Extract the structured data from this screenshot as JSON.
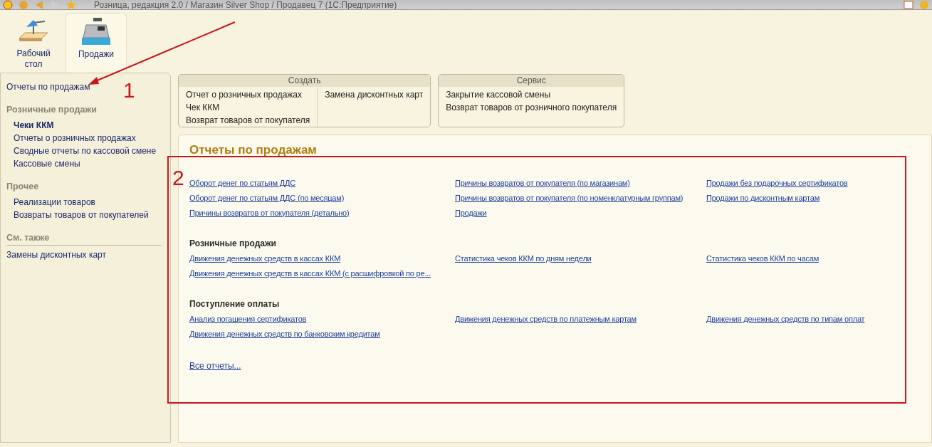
{
  "window": {
    "title": "Розница, редакция 2.0 / Магазин Silver Shop / Продавец 7  (1С:Предприятие)"
  },
  "sections": [
    {
      "label": "Рабочий стол",
      "kind": "desk",
      "selected": false
    },
    {
      "label": "Продажи",
      "kind": "register",
      "selected": true
    }
  ],
  "sidebar": {
    "top_link": "Отчеты по продажам",
    "groups": [
      {
        "title": "Розничные продажи",
        "items": [
          {
            "label": "Чеки ККМ",
            "selected": true
          },
          {
            "label": "Отчеты о розничных продажах",
            "selected": false
          },
          {
            "label": "Сводные отчеты по кассовой смене",
            "selected": false
          },
          {
            "label": "Кассовые смены",
            "selected": false
          }
        ]
      },
      {
        "title": "Прочее",
        "items": [
          {
            "label": "Реализации товаров",
            "selected": false
          },
          {
            "label": "Возвраты товаров от покупателей",
            "selected": false
          }
        ]
      }
    ],
    "see_also": {
      "title": "См. также",
      "items": [
        "Замены дисконтных карт"
      ]
    }
  },
  "command_panels": [
    {
      "title": "Создать",
      "columns": [
        [
          "Отчет о розничных продажах",
          "Чек ККМ",
          "Возврат товаров от покупателя"
        ],
        [
          "Замена дисконтных карт"
        ]
      ]
    },
    {
      "title": "Сервис",
      "columns": [
        [
          "Закрытие кассовой смены",
          "Возврат товаров от розничного покупателя"
        ]
      ]
    }
  ],
  "reports": {
    "title": "Отчеты по продажам",
    "groups": [
      {
        "columns": [
          [
            "Оборот денег по статьям ДДС",
            "Оборот денег по статьям ДДС (по месяцам)",
            "Причины возвратов от покупателя (детально)"
          ],
          [
            "Причины возвратов от покупателя (по магазинам)",
            "Причины возвратов от покупателя (по номенклатурным группам)",
            "Продажи"
          ],
          [
            "Продажи без подарочных сертификатов",
            "Продажи по дисконтным картам"
          ]
        ]
      },
      {
        "title": "Розничные продажи",
        "columns": [
          [
            "Движения денежных средств в кассах ККМ",
            "Движения денежных средств в кассах ККМ (с расшифровкой по ре..."
          ],
          [
            "Статистика чеков ККМ по дням недели"
          ],
          [
            "Статистика чеков ККМ по часам"
          ]
        ]
      },
      {
        "title": "Поступление оплаты",
        "columns": [
          [
            "Анализ погашения сертификатов",
            "Движения денежных средств по банковским кредитам"
          ],
          [
            "Движения денежных средств по платежным картам"
          ],
          [
            "Движения денежных средств по типам оплат"
          ]
        ]
      }
    ],
    "all_reports": "Все отчеты..."
  },
  "annotations": [
    {
      "kind": "arrow",
      "label": "1"
    },
    {
      "kind": "box",
      "label": "2"
    }
  ]
}
